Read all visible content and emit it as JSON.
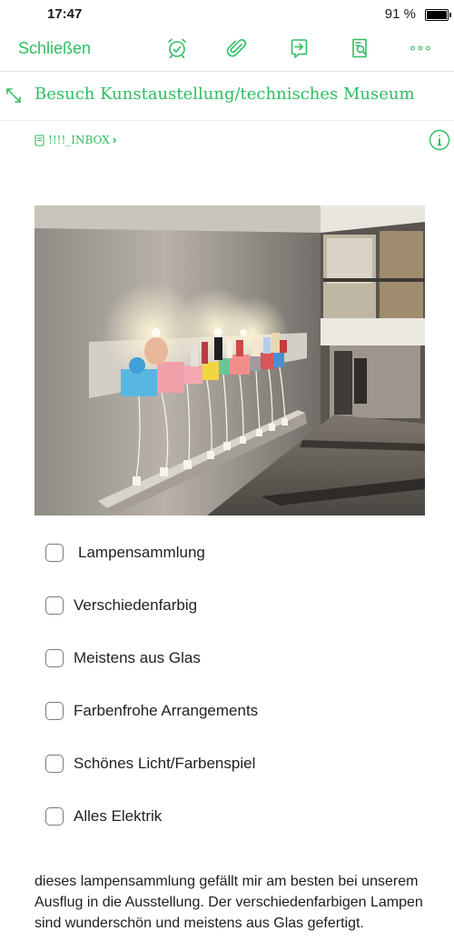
{
  "status": {
    "time": "17:47",
    "battery": "91 %",
    "battery_level": 0.91
  },
  "toolbar": {
    "close_label": "Schließen",
    "icons": [
      "alarm-clock-icon",
      "paperclip-icon",
      "share-icon",
      "search-note-icon",
      "more-icon"
    ]
  },
  "note": {
    "title": "Besuch Kunstaustellung/technisches Museum",
    "notebook": "!!!!_INBOX",
    "checklist": [
      {
        "label": "Lampensammlung",
        "checked": false
      },
      {
        "label": "Verschiedenfarbig",
        "checked": false
      },
      {
        "label": "Meistens aus Glas",
        "checked": false
      },
      {
        "label": "Farbenfrohe Arrangements",
        "checked": false
      },
      {
        "label": "Schönes Licht/Farbenspiel",
        "checked": false
      },
      {
        "label": "Alles Elektrik",
        "checked": false
      }
    ],
    "body": "dieses lampensammlung gefällt mir am besten bei unserem Ausflug in die Ausstellung. Der verschiedenfarbigen Lampen sind wunderschön und meistens aus Glas gefertigt."
  },
  "colors": {
    "accent": "#2dbe60"
  }
}
